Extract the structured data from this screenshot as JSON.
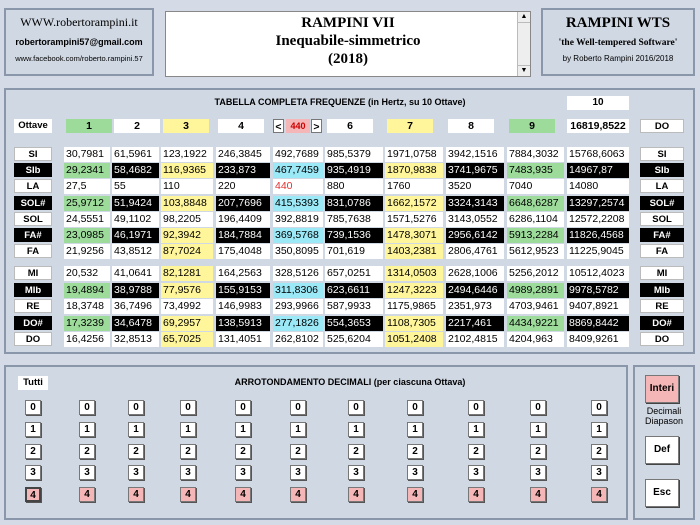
{
  "header": {
    "site": "WWW.robertorampini.it",
    "email": "robertorampini57@gmail.com",
    "facebook": "www.facebook.com/roberto.rampini.57",
    "title_line1": "RAMPINI VII",
    "title_line2": "Inequabile-simmetrico",
    "title_line3": "(2018)",
    "brand": "RAMPINI WTS",
    "brand_tagline": "'the Well-tempered Software'",
    "brand_credit": "by Roberto Rampini 2016/2018"
  },
  "freq_table": {
    "title": "TABELLA COMPLETA FREQUENZE (in Hertz, su 10 Ottave)",
    "octave_count": "10",
    "octaves_label": "Ottave",
    "octaves": [
      "1",
      "2",
      "3",
      "4",
      "5",
      "6",
      "7",
      "8",
      "9"
    ],
    "diapason": "440",
    "prev_label": "<",
    "next_label": ">",
    "top_right_value": "16819,8522",
    "top_right_note": "DO",
    "rows": [
      {
        "note": "SI",
        "dark": false,
        "values": [
          "30,7981",
          "61,5961",
          "123,1922",
          "246,3845",
          "492,7689",
          "985,5379",
          "1971,0758",
          "3942,1516",
          "7884,3032",
          "15768,6063"
        ],
        "colors": [
          "w",
          "w",
          "w",
          "w",
          "w",
          "w",
          "w",
          "w",
          "w",
          "w"
        ]
      },
      {
        "note": "SIb",
        "dark": true,
        "values": [
          "29,2341",
          "58,4682",
          "116,9365",
          "233,873",
          "467,7459",
          "935,4919",
          "1870,9838",
          "3741,9675",
          "7483,935",
          "14967,87"
        ],
        "colors": [
          "g",
          "k",
          "y",
          "k",
          "c",
          "k",
          "y",
          "k",
          "g",
          "k"
        ]
      },
      {
        "note": "LA",
        "dark": false,
        "values": [
          "27,5",
          "55",
          "110",
          "220",
          "440",
          "880",
          "1760",
          "3520",
          "7040",
          "14080"
        ],
        "colors": [
          "w",
          "w",
          "w",
          "w",
          "w",
          "w",
          "w",
          "w",
          "w",
          "w"
        ]
      },
      {
        "note": "SOL#",
        "dark": true,
        "values": [
          "25,9712",
          "51,9424",
          "103,8848",
          "207,7696",
          "415,5393",
          "831,0786",
          "1662,1572",
          "3324,3143",
          "6648,6287",
          "13297,2574"
        ],
        "colors": [
          "g",
          "k",
          "y",
          "k",
          "c",
          "k",
          "y",
          "k",
          "g",
          "k"
        ]
      },
      {
        "note": "SOL",
        "dark": false,
        "values": [
          "24,5551",
          "49,1102",
          "98,2205",
          "196,4409",
          "392,8819",
          "785,7638",
          "1571,5276",
          "3143,0552",
          "6286,1104",
          "12572,2208"
        ],
        "colors": [
          "w",
          "w",
          "w",
          "w",
          "w",
          "w",
          "w",
          "w",
          "w",
          "w"
        ]
      },
      {
        "note": "FA#",
        "dark": true,
        "values": [
          "23,0985",
          "46,1971",
          "92,3942",
          "184,7884",
          "369,5768",
          "739,1536",
          "1478,3071",
          "2956,6142",
          "5913,2284",
          "11826,4568"
        ],
        "colors": [
          "g",
          "k",
          "y",
          "k",
          "c",
          "k",
          "y",
          "k",
          "g",
          "k"
        ]
      },
      {
        "note": "FA",
        "dark": false,
        "values": [
          "21,9256",
          "43,8512",
          "87,7024",
          "175,4048",
          "350,8095",
          "701,619",
          "1403,2381",
          "2806,4761",
          "5612,9523",
          "11225,9045"
        ],
        "colors": [
          "w",
          "w",
          "y",
          "w",
          "w",
          "w",
          "y",
          "w",
          "w",
          "w"
        ]
      },
      {
        "note": "MI",
        "dark": false,
        "values": [
          "20,532",
          "41,0641",
          "82,1281",
          "164,2563",
          "328,5126",
          "657,0251",
          "1314,0503",
          "2628,1006",
          "5256,2012",
          "10512,4023"
        ],
        "colors": [
          "w",
          "w",
          "y",
          "w",
          "w",
          "w",
          "y",
          "w",
          "w",
          "w"
        ]
      },
      {
        "note": "MIb",
        "dark": true,
        "values": [
          "19,4894",
          "38,9788",
          "77,9576",
          "155,9153",
          "311,8306",
          "623,6611",
          "1247,3223",
          "2494,6446",
          "4989,2891",
          "9978,5782"
        ],
        "colors": [
          "g",
          "k",
          "y",
          "k",
          "c",
          "k",
          "y",
          "k",
          "g",
          "k"
        ]
      },
      {
        "note": "RE",
        "dark": false,
        "values": [
          "18,3748",
          "36,7496",
          "73,4992",
          "146,9983",
          "293,9966",
          "587,9933",
          "1175,9865",
          "2351,973",
          "4703,9461",
          "9407,8921"
        ],
        "colors": [
          "w",
          "w",
          "w",
          "w",
          "w",
          "w",
          "w",
          "w",
          "w",
          "w"
        ]
      },
      {
        "note": "DO#",
        "dark": true,
        "values": [
          "17,3239",
          "34,6478",
          "69,2957",
          "138,5913",
          "277,1826",
          "554,3653",
          "1108,7305",
          "2217,461",
          "4434,9221",
          "8869,8442"
        ],
        "colors": [
          "g",
          "k",
          "y",
          "k",
          "c",
          "k",
          "y",
          "k",
          "g",
          "k"
        ]
      },
      {
        "note": "DO",
        "dark": false,
        "values": [
          "16,4256",
          "32,8513",
          "65,7025",
          "131,4051",
          "262,8102",
          "525,6204",
          "1051,2408",
          "2102,4815",
          "4204,963",
          "8409,9261"
        ],
        "colors": [
          "w",
          "w",
          "y",
          "w",
          "w",
          "w",
          "y",
          "w",
          "w",
          "w"
        ]
      }
    ]
  },
  "rounding": {
    "title": "ARROTONDAMENTO DECIMALI (per ciascuna Ottava)",
    "all_label": "Tutti",
    "options": [
      "0",
      "1",
      "2",
      "3",
      "4"
    ],
    "selected": "4",
    "interi_label": "Interi",
    "decimali_label": "Decimali",
    "diapason_label": "Diapason",
    "def_label": "Def",
    "esc_label": "Esc"
  },
  "colors": {
    "accent_green": "#9ddb9b",
    "accent_yellow": "#fff59a",
    "accent_cyan": "#9be8f7",
    "diapason_red": "#e53030",
    "selected_pink": "#f4b6b6"
  }
}
